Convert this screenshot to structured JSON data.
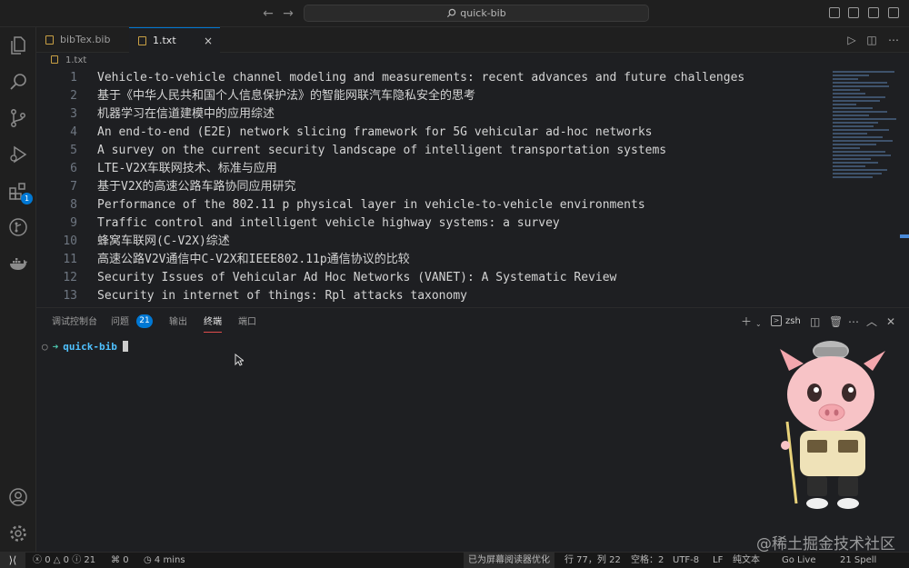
{
  "titlebar": {
    "search": "quick-bib"
  },
  "activity": {
    "extensions_badge": "1"
  },
  "tabs": [
    {
      "label": "bibTex.bib",
      "active": false
    },
    {
      "label": "1.txt",
      "active": true,
      "close": "×"
    }
  ],
  "breadcrumb": {
    "file": "1.txt"
  },
  "editor": {
    "lines": [
      {
        "num": "1",
        "text": "Vehicle-to-vehicle channel modeling and measurements: recent advances and future challenges"
      },
      {
        "num": "2",
        "text": "基于《中华人民共和国个人信息保护法》的智能网联汽车隐私安全的思考"
      },
      {
        "num": "3",
        "text": "机器学习在信道建模中的应用综述"
      },
      {
        "num": "4",
        "text": "An end-to-end (E2E) network slicing framework for 5G vehicular ad-hoc networks"
      },
      {
        "num": "5",
        "text": "A survey on the current security landscape of intelligent transportation systems"
      },
      {
        "num": "6",
        "text": "LTE-V2X车联网技术、标准与应用"
      },
      {
        "num": "7",
        "text": "基于V2X的高速公路车路协同应用研究"
      },
      {
        "num": "8",
        "text": "Performance of the 802.11 p physical layer in vehicle-to-vehicle environments"
      },
      {
        "num": "9",
        "text": "Traffic control and intelligent vehicle highway systems: a survey"
      },
      {
        "num": "10",
        "text": "蜂窝车联网(C-V2X)综述"
      },
      {
        "num": "11",
        "text": "高速公路V2V通信中C-V2X和IEEE802.11p通信协议的比较"
      },
      {
        "num": "12",
        "text": "Security Issues of Vehicular Ad Hoc Networks (VANET): A Systematic Review"
      },
      {
        "num": "13",
        "text": "Security in internet of things: Rpl attacks taxonomy"
      }
    ]
  },
  "panel": {
    "tabs": [
      "调试控制台",
      "问题",
      "输出",
      "终端",
      "端口"
    ],
    "problems_count": "21",
    "shell": "zsh",
    "prompt_dir": "quick-bib"
  },
  "watermark": "@稀土掘金技术社区",
  "status": {
    "errors": "0",
    "warnings": "0",
    "info": "21",
    "ports": "0",
    "time": "4 mins",
    "screen_reader": "已为屏幕阅读器优化",
    "position": "行 77，列 22",
    "spaces": "空格：2",
    "encoding": "UTF-8",
    "eol": "LF",
    "language": "纯文本",
    "go_live": "Go Live",
    "spell": "21 Spell"
  }
}
